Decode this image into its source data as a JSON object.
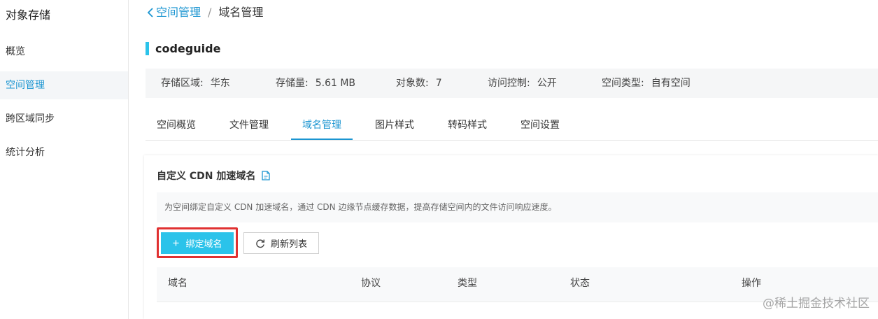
{
  "sidebar": {
    "title": "对象存储",
    "items": [
      {
        "label": "概览"
      },
      {
        "label": "空间管理"
      },
      {
        "label": "跨区域同步"
      },
      {
        "label": "统计分析"
      }
    ]
  },
  "breadcrumb": {
    "back_label": "空间管理",
    "separator": "/",
    "current": "域名管理"
  },
  "bucket": {
    "name": "codeguide"
  },
  "info": {
    "region_label": "存储区域:",
    "region_value": "华东",
    "storage_label": "存储量:",
    "storage_value": "5.61 MB",
    "objects_label": "对象数:",
    "objects_value": "7",
    "access_label": "访问控制:",
    "access_value": "公开",
    "type_label": "空间类型:",
    "type_value": "自有空间"
  },
  "tabs": [
    {
      "label": "空间概览"
    },
    {
      "label": "文件管理"
    },
    {
      "label": "域名管理"
    },
    {
      "label": "图片样式"
    },
    {
      "label": "转码样式"
    },
    {
      "label": "空间设置"
    }
  ],
  "panel": {
    "title": "自定义 CDN 加速域名",
    "tip": "为空间绑定自定义 CDN 加速域名，通过 CDN 边缘节点缓存数据，提高存储空间内的文件访问响应速度。",
    "bind_button": "绑定域名",
    "refresh_button": "刷新列表"
  },
  "table": {
    "columns": [
      "域名",
      "协议",
      "类型",
      "状态",
      "操作"
    ]
  },
  "watermark": "@稀土掘金技术社区",
  "colors": {
    "accent": "#1b95d1",
    "primary_button": "#2bc3ea",
    "highlight": "#e03131"
  }
}
